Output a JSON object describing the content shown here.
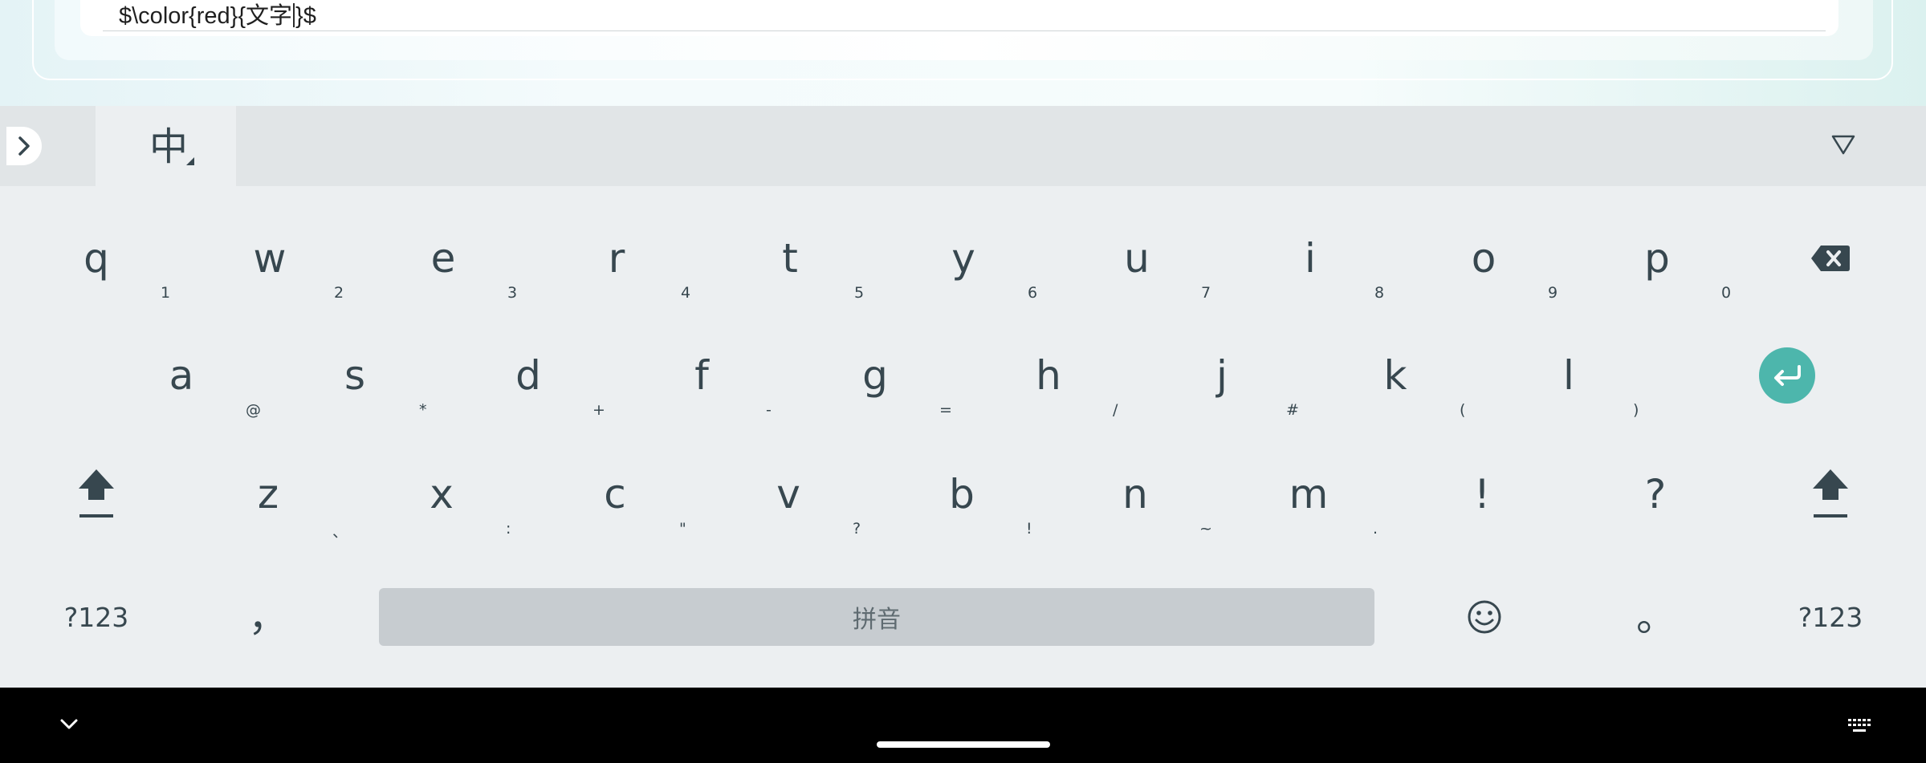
{
  "editor": {
    "text_before_caret": "$\\color{red}{文字",
    "text_after_caret": "}$"
  },
  "toolbar": {
    "expand_icon": "chevron-right-icon",
    "language_label": "中",
    "collapse_icon": "triangle-down-icon"
  },
  "keyboard": {
    "row1": [
      {
        "key": "q",
        "hint": "1"
      },
      {
        "key": "w",
        "hint": "2"
      },
      {
        "key": "e",
        "hint": "3"
      },
      {
        "key": "r",
        "hint": "4"
      },
      {
        "key": "t",
        "hint": "5"
      },
      {
        "key": "y",
        "hint": "6"
      },
      {
        "key": "u",
        "hint": "7"
      },
      {
        "key": "i",
        "hint": "8"
      },
      {
        "key": "o",
        "hint": "9"
      },
      {
        "key": "p",
        "hint": "0"
      }
    ],
    "row2": [
      {
        "key": "a",
        "hint": "@"
      },
      {
        "key": "s",
        "hint": "*"
      },
      {
        "key": "d",
        "hint": "+"
      },
      {
        "key": "f",
        "hint": "-"
      },
      {
        "key": "g",
        "hint": "="
      },
      {
        "key": "h",
        "hint": "/"
      },
      {
        "key": "j",
        "hint": "#"
      },
      {
        "key": "k",
        "hint": "("
      },
      {
        "key": "l",
        "hint": ")"
      }
    ],
    "row3": [
      {
        "key": "z",
        "hint": "、"
      },
      {
        "key": "x",
        "hint": ":"
      },
      {
        "key": "c",
        "hint": "\""
      },
      {
        "key": "v",
        "hint": "?"
      },
      {
        "key": "b",
        "hint": "!"
      },
      {
        "key": "n",
        "hint": "~"
      },
      {
        "key": "m",
        "hint": "."
      },
      {
        "key": "!",
        "hint": ""
      },
      {
        "key": "?",
        "hint": ""
      }
    ],
    "symbols_left_label": "?123",
    "comma_label": "，",
    "space_label": "拼音",
    "period_label": "。",
    "symbols_right_label": "?123",
    "backspace_icon": "backspace-icon",
    "enter_icon": "enter-icon",
    "shift_icon": "shift-icon",
    "emoji_icon": "emoji-icon",
    "accent_color": "#4db6ac"
  },
  "navbar": {
    "back_icon": "chevron-down-icon",
    "keyboard_icon": "keyboard-icon"
  }
}
